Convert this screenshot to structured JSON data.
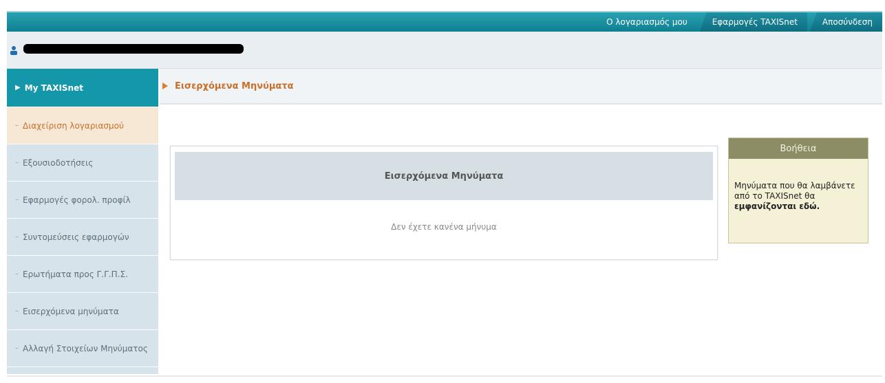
{
  "topnav": {
    "account": "Ο λογαριασμός μου",
    "apps": "Εφαρμογές TAXISnet",
    "logout": "Αποσύνδεση"
  },
  "user": {
    "icon": "user-icon",
    "name": "████████████████████████████████"
  },
  "sidebar": {
    "items": [
      {
        "label": "My TAXISnet"
      },
      {
        "label": "Διαχείριση λογαριασμού"
      },
      {
        "label": "Εξουσιοδοτήσεις"
      },
      {
        "label": "Εφαρμογές φορολ. προφίλ"
      },
      {
        "label": "Συντομεύσεις εφαρμογών"
      },
      {
        "label": "Ερωτήματα προς Γ.Γ.Π.Σ."
      },
      {
        "label": "Εισερχόμενα μηνύματα"
      },
      {
        "label": "Αλλαγή Στοιχείων Μηνύματος"
      }
    ]
  },
  "content": {
    "title": "Εισερχόμενα Μηνύματα",
    "panel_title": "Εισερχόμενα Μηνύματα",
    "empty_message": "Δεν έχετε κανένα μήνυμα"
  },
  "help": {
    "title": "Βοήθεια",
    "text_part1": "Μηνύματα που θα λαμβάνετε από το TAXISnet θα ",
    "text_part2": "εμφανίζονται εδώ."
  },
  "colors": {
    "accent": "#1497a8",
    "active_item_text": "#c8702a",
    "help_header": "#8c8d64"
  }
}
